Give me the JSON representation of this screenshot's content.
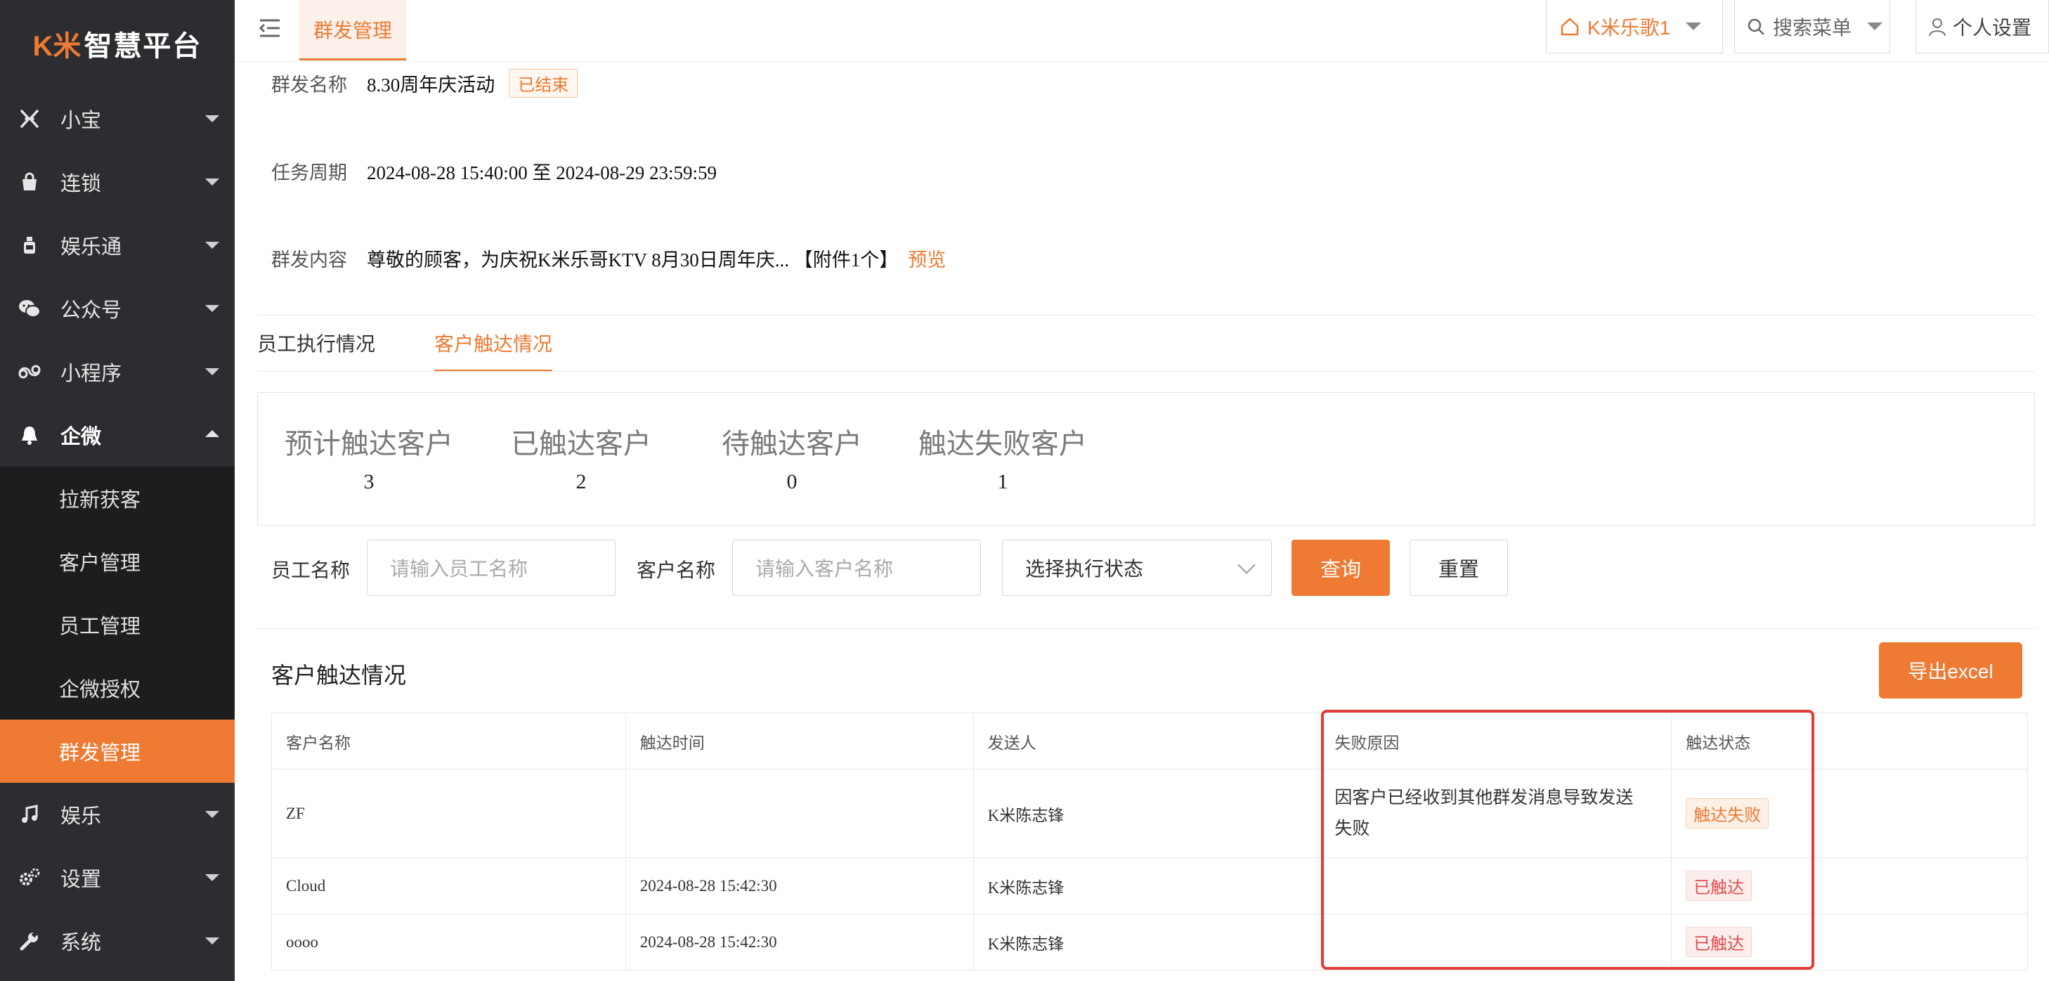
{
  "app": {
    "logo_mark": "K米",
    "logo_text": "智慧平台"
  },
  "sidebar": {
    "items": [
      {
        "label": "小宝"
      },
      {
        "label": "连锁"
      },
      {
        "label": "娱乐通"
      },
      {
        "label": "公众号"
      },
      {
        "label": "小程序"
      },
      {
        "label": "企微"
      },
      {
        "label": "娱乐"
      },
      {
        "label": "设置"
      },
      {
        "label": "系统"
      }
    ],
    "submenu": [
      {
        "label": "拉新获客"
      },
      {
        "label": "客户管理"
      },
      {
        "label": "员工管理"
      },
      {
        "label": "企微授权"
      },
      {
        "label": "群发管理"
      }
    ]
  },
  "topbar": {
    "active_tab": "群发管理",
    "store": "K米乐歌1",
    "search": "搜索菜单",
    "user": "个人设置"
  },
  "info": {
    "name_label": "群发名称",
    "name_value": "8.30周年庆活动",
    "status_tag": "已结束",
    "period_label": "任务周期",
    "period_value": "2024-08-28 15:40:00 至 2024-08-29 23:59:59",
    "content_label": "群发内容",
    "content_value": "尊敬的顾客，为庆祝K米乐哥KTV 8月30日周年庆... 【附件1个】",
    "preview_link": "预览"
  },
  "tabs": [
    {
      "label": "员工执行情况"
    },
    {
      "label": "客户触达情况"
    }
  ],
  "stats": [
    {
      "label": "预计触达客户",
      "value": "3"
    },
    {
      "label": "已触达客户",
      "value": "2"
    },
    {
      "label": "待触达客户",
      "value": "0"
    },
    {
      "label": "触达失败客户",
      "value": "1"
    }
  ],
  "filter": {
    "employee_label": "员工名称",
    "employee_placeholder": "请输入员工名称",
    "customer_label": "客户名称",
    "customer_placeholder": "请输入客户名称",
    "status_select": "选择执行状态",
    "query_button": "查询",
    "reset_button": "重置"
  },
  "section": {
    "title": "客户触达情况",
    "export_button": "导出excel"
  },
  "table": {
    "headers": [
      "客户名称",
      "触达时间",
      "发送人",
      "失败原因",
      "触达状态"
    ],
    "rows": [
      {
        "customer": "ZF",
        "time": "",
        "sender": "K米陈志锋",
        "reason": "因客户已经收到其他群发消息导致发送失败",
        "status": "触达失败"
      },
      {
        "customer": "Cloud",
        "time": "2024-08-28 15:42:30",
        "sender": "K米陈志锋",
        "reason": "",
        "status": "已触达"
      },
      {
        "customer": "oooo",
        "time": "2024-08-28 15:42:30",
        "sender": "K米陈志锋",
        "reason": "",
        "status": "已触达"
      }
    ]
  },
  "colors": {
    "accent": "#ee7a33",
    "sidebar_bg": "#2b2d30",
    "highlight": "#e13a3a"
  }
}
